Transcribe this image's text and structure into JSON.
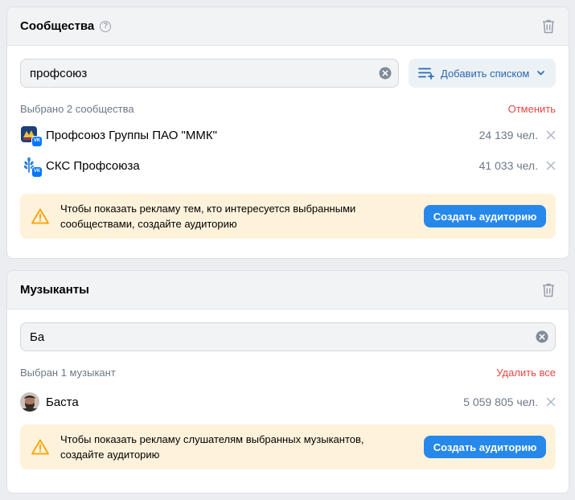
{
  "communities": {
    "title": "Сообщества",
    "search_value": "профсоюз",
    "add_list_label": "Добавить списком",
    "selected_label": "Выбрано 2 сообщества",
    "cancel_label": "Отменить",
    "items": [
      {
        "name": "Профсоюз Группы ПАО \"ММК\"",
        "count": "24 139 чел."
      },
      {
        "name": "СКС Профсоюза",
        "count": "41 033 чел."
      }
    ],
    "alert_text": "Чтобы показать рекламу тем, кто интересуется выбранными сообществами, создайте аудиторию",
    "alert_button": "Создать аудиторию"
  },
  "musicians": {
    "title": "Музыканты",
    "search_value": "Ба",
    "selected_label": "Выбран 1 музыкант",
    "delete_all_label": "Удалить все",
    "items": [
      {
        "name": "Баста",
        "count": "5 059 805 чел."
      }
    ],
    "alert_text": "Чтобы показать рекламу слушателям выбранных музыкантов, создайте аудиторию",
    "alert_button": "Создать аудиторию"
  },
  "colors": {
    "accent": "#2688eb",
    "danger": "#e64646",
    "warning_bg": "#fff2db",
    "warning_icon": "#ffa000"
  },
  "icons": {
    "vk_badge_text": "VK"
  }
}
